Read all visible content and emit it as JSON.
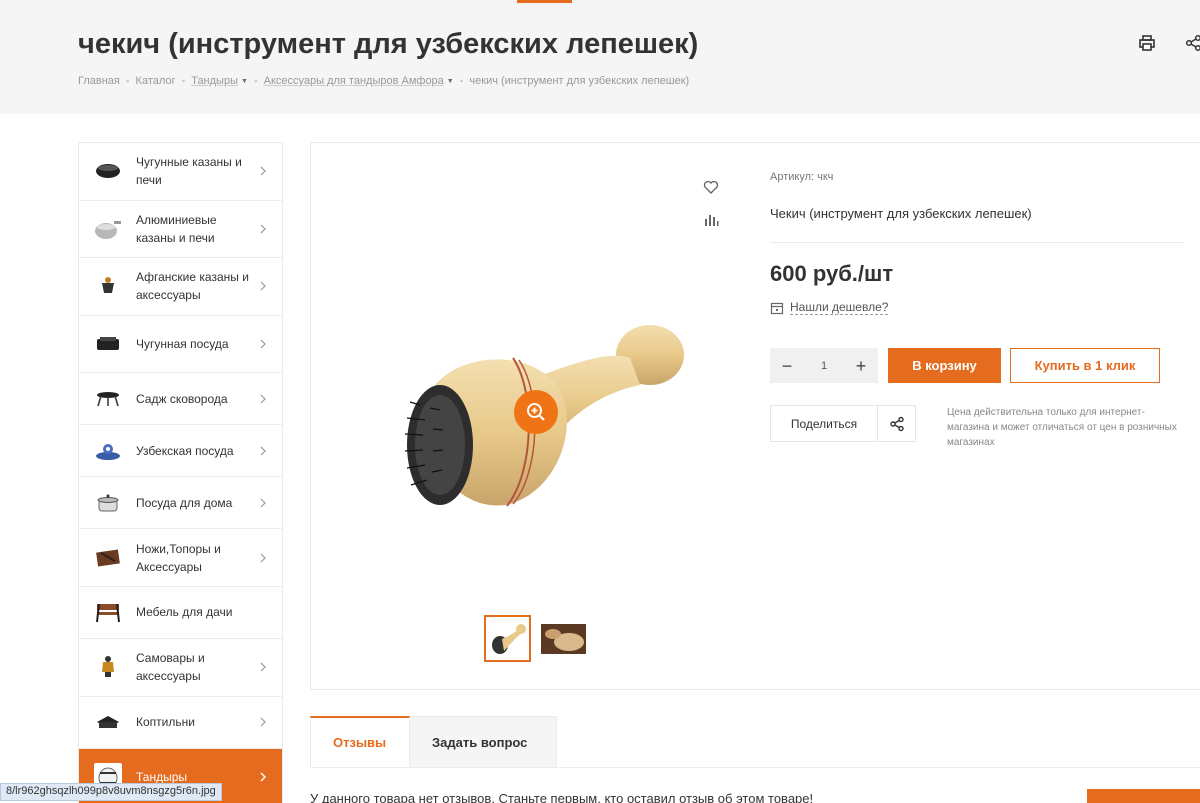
{
  "header": {
    "title": "чекич (инструмент для узбекских лепешек)",
    "breadcrumb": [
      {
        "label": "Главная"
      },
      {
        "label": "Каталог"
      },
      {
        "label": "Тандыры"
      },
      {
        "label": "Аксессуары для тандыров Амфора"
      },
      {
        "label": "чекич (инструмент для узбекских лепешек)"
      }
    ],
    "separator": "-",
    "print_icon": "print-icon",
    "share_icon": "share-icon"
  },
  "sidebar": {
    "items": [
      {
        "label": "Чугунные казаны и печи",
        "icon": "cauldron-thumb"
      },
      {
        "label": "Алюминиевые казаны и печи",
        "icon": "aluminum-cauldron-thumb"
      },
      {
        "label": "Афганские казаны и аксессуары",
        "icon": "afghan-cauldron-thumb"
      },
      {
        "label": "Чугунная посуда",
        "icon": "cast-iron-pan-thumb"
      },
      {
        "label": "Садж сковорода",
        "icon": "sadj-thumb"
      },
      {
        "label": "Узбекская посуда",
        "icon": "uzbek-dishes-thumb"
      },
      {
        "label": "Посуда для дома",
        "icon": "pot-thumb"
      },
      {
        "label": "Ножи,Топоры и Аксессуары",
        "icon": "knives-thumb"
      },
      {
        "label": "Мебель для дачи",
        "icon": "bench-thumb"
      },
      {
        "label": "Самовары и аксессуары",
        "icon": "samovar-thumb"
      },
      {
        "label": "Коптильни",
        "icon": "smoker-thumb"
      },
      {
        "label": "Тандыры",
        "icon": "tandoor-thumb",
        "active": true
      }
    ]
  },
  "product": {
    "sku_label": "Артикул: чкч",
    "short_name": "Чекич (инструмент для узбекских лепешек)",
    "price": "600 руб./шт",
    "cheaper_link": "Нашли дешевле?",
    "quantity": "1",
    "cart_button": "В корзину",
    "one_click_button": "Купить в 1 клик",
    "share_label": "Поделиться",
    "price_note": "Цена действительна только для интернет-магазина и может отличаться от цен в розничных магазинах"
  },
  "tabs": [
    {
      "label": "Отзывы",
      "active": true
    },
    {
      "label": "Задать вопрос",
      "active": false
    }
  ],
  "reviews": {
    "empty_text": "У данного товара нет отзывов. Станьте первым, кто оставил отзыв об этом товаре!"
  },
  "status_bar": {
    "url": "8/lr962ghsqzlh099p8v8uvm8nsgzg5r6n.jpg"
  },
  "colors": {
    "accent": "#e56b1f",
    "header_bg": "#f5f5f5"
  }
}
